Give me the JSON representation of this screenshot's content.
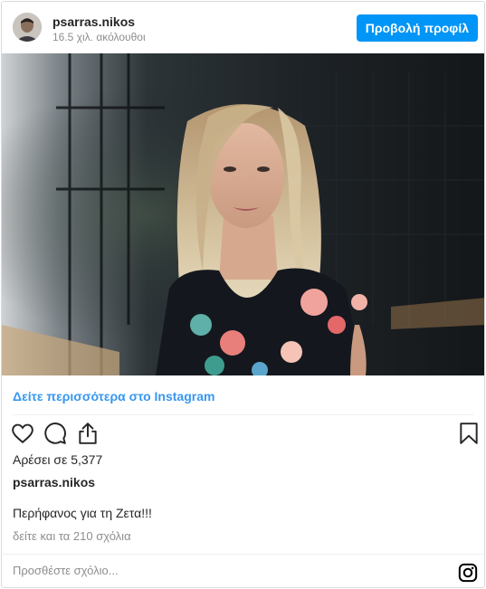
{
  "header": {
    "username": "psarras.nikos",
    "followers": "16.5 χιλ. ακόλουθοι",
    "view_profile_label": "Προβολή προφίλ"
  },
  "post": {
    "see_more_label": "Δείτε περισσότερα στο Instagram",
    "likes_label": "Αρέσει σε 5,377",
    "caption_user": "psarras.nikos",
    "caption_text": "Περήφανος για τη Ζετα!!!",
    "view_comments_label": "δείτε και τα 210 σχόλια",
    "comment_placeholder": "Προσθέστε σχόλιο..."
  },
  "icons": {
    "like": "heart-icon",
    "comment": "comment-bubble-icon",
    "share": "share-icon",
    "save": "bookmark-icon",
    "brand": "instagram-logo-icon"
  },
  "colors": {
    "accent": "#0095f6",
    "link": "#3897f0",
    "muted": "#8e8e8e",
    "text": "#262626"
  }
}
